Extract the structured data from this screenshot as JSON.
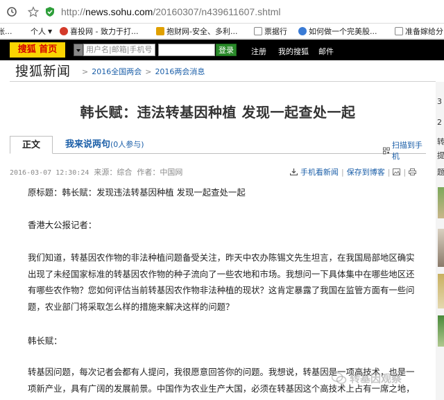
{
  "browser": {
    "url_prefix": "http://",
    "url_host": "news.sohu.com",
    "url_path": "/20160307/n439611607.shtml"
  },
  "bookmarks": [
    {
      "label": "张..."
    },
    {
      "label": "个人"
    },
    {
      "label": "喜投网 - 致力于打..."
    },
    {
      "label": "抱财网-安全、多利..."
    },
    {
      "label": "票据行"
    },
    {
      "label": "如何做一个完美股..."
    },
    {
      "label": "准备嫁给分"
    }
  ],
  "sohu_bar": {
    "logo": "搜狐 首页",
    "user_placeholder": "用户名|邮箱|手机号",
    "login_button": "登录",
    "links": [
      "注册",
      "我的搜狐",
      "邮件"
    ]
  },
  "site": {
    "logo": "搜狐新闻",
    "breadcrumbs": [
      "2016全国两会",
      "2016两会消息"
    ]
  },
  "article": {
    "title": "韩长赋：违法转基因种植 发现一起查处一起",
    "tabs": {
      "main": "正文",
      "comment": "我来说两句",
      "comment_count": "(0人参与)"
    },
    "scan_label": "扫描到手机",
    "meta": {
      "date": "2016-03-07 12:30:24",
      "source": "来源：综合",
      "author": "作者：中国网"
    },
    "actions": {
      "mobile": "手机看新闻",
      "save": "保存到博客"
    },
    "paragraphs": [
      "原标题：韩长赋：发现违法转基因种植 发现一起查处一起",
      "香港大公报记者：",
      "我们知道，转基因农作物的非法种植问题备受关注，昨天中农办陈锡文先生坦言，在我国局部地区确实出现了未经国家标准的转基因农作物的种子流向了一些农地和市场。我想问一下具体集中在哪些地区还有哪些农作物？您如何评估当前转基因农作物非法种植的现状？这肯定暴露了我国在监管方面有一些问题，农业部门将采取怎么样的措施来解决这样的问题？",
      "韩长赋：",
      "转基因问题，每次记者会都有人提问，我很愿意回答你的问题。我想说，转基因是一项高技术，也是一项新产业，具有广阔的发展前景。中国作为农业生产大国，必须在转基因这个高技术上占有一席之地，"
    ]
  },
  "right_panel": {
    "chars": [
      "3",
      "2",
      "转",
      "提",
      "题"
    ]
  },
  "watermark": "转基因观察"
}
